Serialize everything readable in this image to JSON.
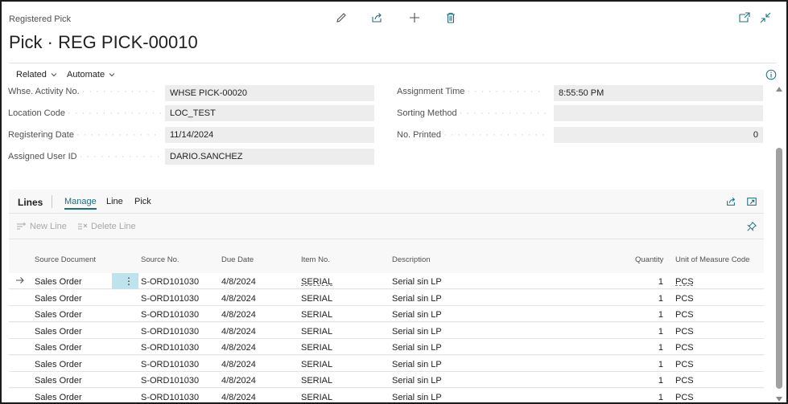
{
  "header": {
    "caption": "Registered Pick",
    "title": "Pick · REG PICK-00010",
    "actions": {
      "edit_icon": "pencil-icon",
      "share_icon": "share-icon",
      "new_icon": "plus-icon",
      "delete_icon": "trash-icon",
      "open_new_window_icon": "open-new-window-icon",
      "collapse_icon": "collapse-icon"
    }
  },
  "actionbar": {
    "related": "Related",
    "automate": "Automate",
    "info_icon": "info-icon"
  },
  "fields": {
    "left": [
      {
        "label": "Whse. Activity No.",
        "value": "WHSE PICK-00020"
      },
      {
        "label": "Location Code",
        "value": "LOC_TEST"
      },
      {
        "label": "Registering Date",
        "value": "11/14/2024"
      },
      {
        "label": "Assigned User ID",
        "value": "DARIO.SANCHEZ"
      }
    ],
    "right": [
      {
        "label": "Assignment Time",
        "value": "8:55:50 PM"
      },
      {
        "label": "Sorting Method",
        "value": ""
      },
      {
        "label": "No. Printed",
        "value": "0"
      }
    ]
  },
  "lines": {
    "title": "Lines",
    "tabs": [
      "Manage",
      "Line",
      "Pick"
    ],
    "tools": {
      "new_line": "New Line",
      "delete_line": "Delete Line"
    },
    "columns": {
      "source_document": "Source Document",
      "source_no": "Source No.",
      "due_date": "Due Date",
      "item_no": "Item No.",
      "description": "Description",
      "quantity": "Quantity",
      "uom": "Unit of Measure Code"
    },
    "rows": [
      {
        "source_document": "Sales Order",
        "source_no": "S-ORD101030",
        "due_date": "4/8/2024",
        "item_no": "SERIAL",
        "description": "Serial sin LP",
        "quantity": "1",
        "uom": "PCS"
      },
      {
        "source_document": "Sales Order",
        "source_no": "S-ORD101030",
        "due_date": "4/8/2024",
        "item_no": "SERIAL",
        "description": "Serial sin LP",
        "quantity": "1",
        "uom": "PCS"
      },
      {
        "source_document": "Sales Order",
        "source_no": "S-ORD101030",
        "due_date": "4/8/2024",
        "item_no": "SERIAL",
        "description": "Serial sin LP",
        "quantity": "1",
        "uom": "PCS"
      },
      {
        "source_document": "Sales Order",
        "source_no": "S-ORD101030",
        "due_date": "4/8/2024",
        "item_no": "SERIAL",
        "description": "Serial sin LP",
        "quantity": "1",
        "uom": "PCS"
      },
      {
        "source_document": "Sales Order",
        "source_no": "S-ORD101030",
        "due_date": "4/8/2024",
        "item_no": "SERIAL",
        "description": "Serial sin LP",
        "quantity": "1",
        "uom": "PCS"
      },
      {
        "source_document": "Sales Order",
        "source_no": "S-ORD101030",
        "due_date": "4/8/2024",
        "item_no": "SERIAL",
        "description": "Serial sin LP",
        "quantity": "1",
        "uom": "PCS"
      },
      {
        "source_document": "Sales Order",
        "source_no": "S-ORD101030",
        "due_date": "4/8/2024",
        "item_no": "SERIAL",
        "description": "Serial sin LP",
        "quantity": "1",
        "uom": "PCS"
      },
      {
        "source_document": "Sales Order",
        "source_no": "S-ORD101030",
        "due_date": "4/8/2024",
        "item_no": "SERIAL",
        "description": "Serial sin LP",
        "quantity": "1",
        "uom": "PCS"
      }
    ]
  },
  "colors": {
    "accent": "#1f6f7a",
    "field_bg": "#ededed",
    "row_selected": "#bfe3ec"
  }
}
